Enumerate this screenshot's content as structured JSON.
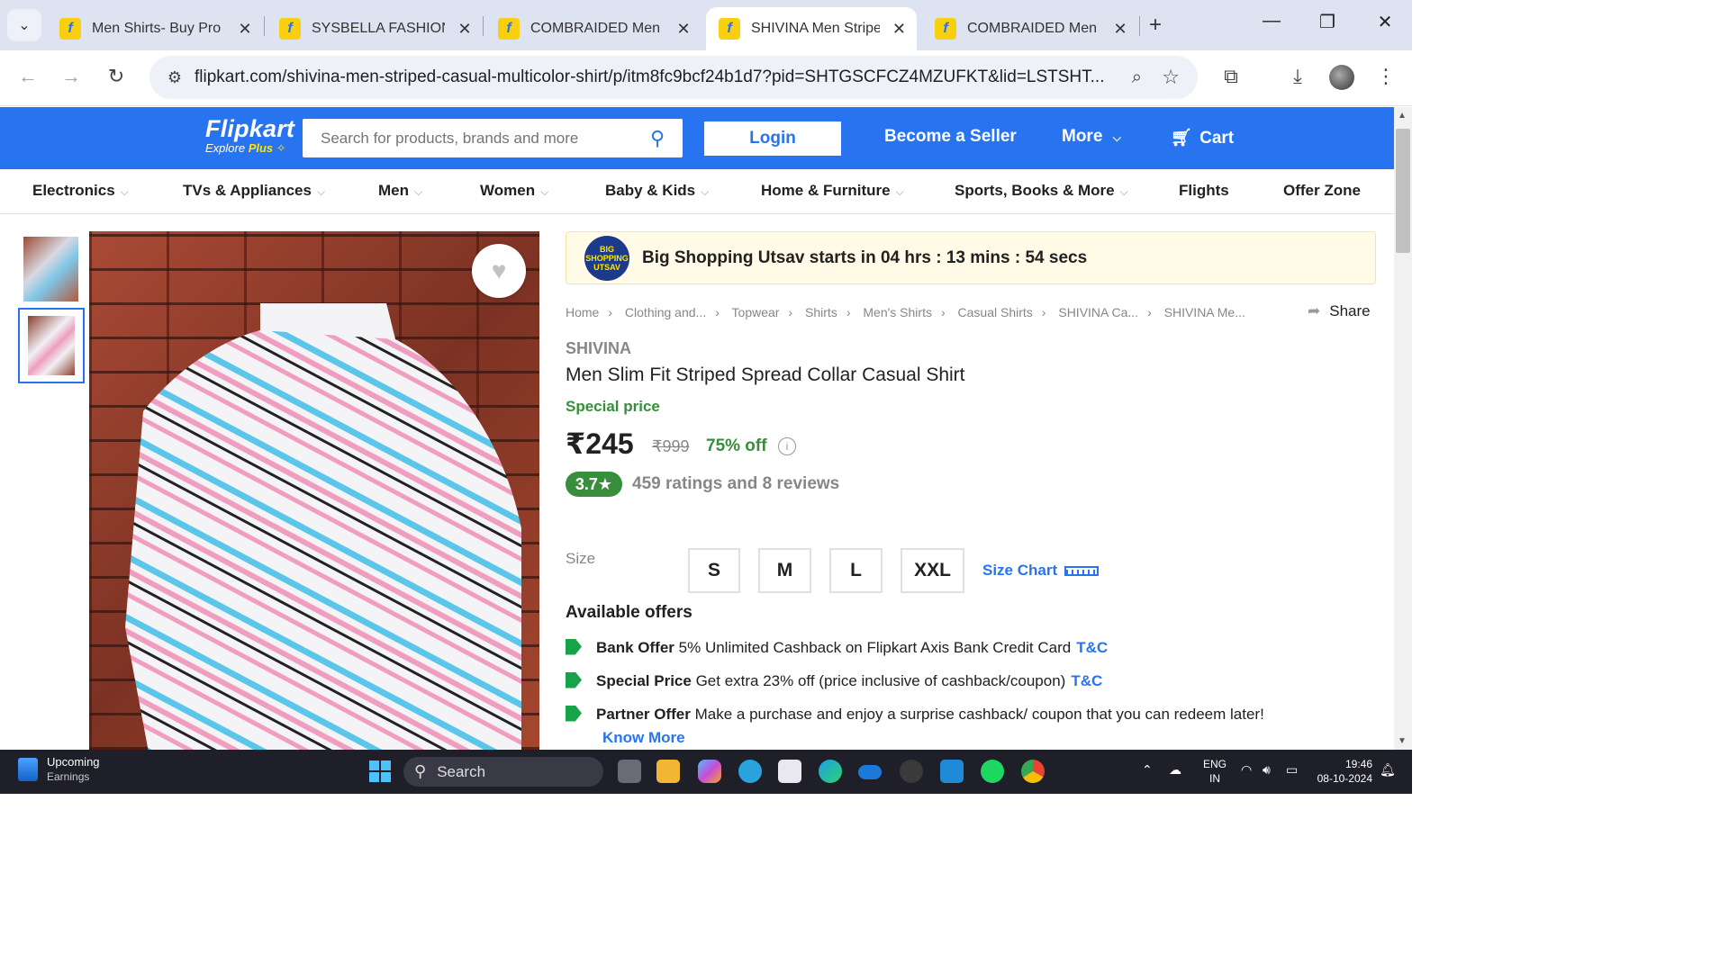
{
  "browser": {
    "tabs": [
      {
        "title": "Men Shirts- Buy Pro",
        "active": false
      },
      {
        "title": "SYSBELLA FASHION",
        "active": false
      },
      {
        "title": "COMBRAIDED Men",
        "active": false
      },
      {
        "title": "SHIVINA Men Stripe",
        "active": true
      },
      {
        "title": "COMBRAIDED Men",
        "active": false
      }
    ],
    "new_tab_icon": "+",
    "url": "flipkart.com/shivina-men-striped-casual-multicolor-shirt/p/itm8fc9bcf24b1d7?pid=SHTGSCFCZ4MZUFKT&lid=LSTSHT..."
  },
  "header": {
    "logo_name": "Flipkart",
    "logo_sub_prefix": "Explore ",
    "logo_sub_plus": "Plus",
    "search_placeholder": "Search for products, brands and more",
    "login_label": "Login",
    "seller_label": "Become a Seller",
    "more_label": "More",
    "cart_label": "Cart",
    "brand_color": "#2874f0"
  },
  "categories": [
    {
      "label": "Electronics",
      "has_menu": true
    },
    {
      "label": "TVs & Appliances",
      "has_menu": true
    },
    {
      "label": "Men",
      "has_menu": true
    },
    {
      "label": "Women",
      "has_menu": true
    },
    {
      "label": "Baby & Kids",
      "has_menu": true
    },
    {
      "label": "Home & Furniture",
      "has_menu": true
    },
    {
      "label": "Sports, Books & More",
      "has_menu": true
    },
    {
      "label": "Flights",
      "has_menu": false
    },
    {
      "label": "Offer Zone",
      "has_menu": false
    }
  ],
  "banner": {
    "badge_text": "BIG SHOPPING UTSAV",
    "text": "Big Shopping Utsav starts in 04 hrs : 13 mins : 54 secs"
  },
  "breadcrumbs": [
    "Home",
    "Clothing and...",
    "Topwear",
    "Shirts",
    "Men's Shirts",
    "Casual Shirts",
    "SHIVINA Ca...",
    "SHIVINA Me..."
  ],
  "share_label": "Share",
  "product": {
    "brand": "SHIVINA",
    "title": "Men Slim Fit Striped Spread Collar Casual Shirt",
    "special_label": "Special price",
    "price": "₹245",
    "mrp": "₹999",
    "discount": "75% off",
    "rating": "3.7★",
    "rating_count": "459 ratings and 8 reviews",
    "size_label": "Size",
    "sizes": [
      "S",
      "M",
      "L",
      "XXL"
    ],
    "size_chart_label": "Size Chart"
  },
  "offers": {
    "heading": "Available offers",
    "items": [
      {
        "type": "Bank Offer",
        "text": "5% Unlimited Cashback on Flipkart Axis Bank Credit Card",
        "link": "T&C"
      },
      {
        "type": "Special Price",
        "text": "Get extra 23% off (price inclusive of cashback/coupon)",
        "link": "T&C"
      },
      {
        "type": "Partner Offer",
        "text": "Make a purchase and enjoy a surprise cashback/ coupon that you can redeem later!",
        "link": ""
      }
    ],
    "know_more": "Know More"
  },
  "taskbar": {
    "weather_title": "Upcoming",
    "weather_sub": "Earnings",
    "search_label": "Search",
    "lang_line1": "ENG",
    "lang_line2": "IN",
    "time": "19:46",
    "date": "08-10-2024"
  }
}
